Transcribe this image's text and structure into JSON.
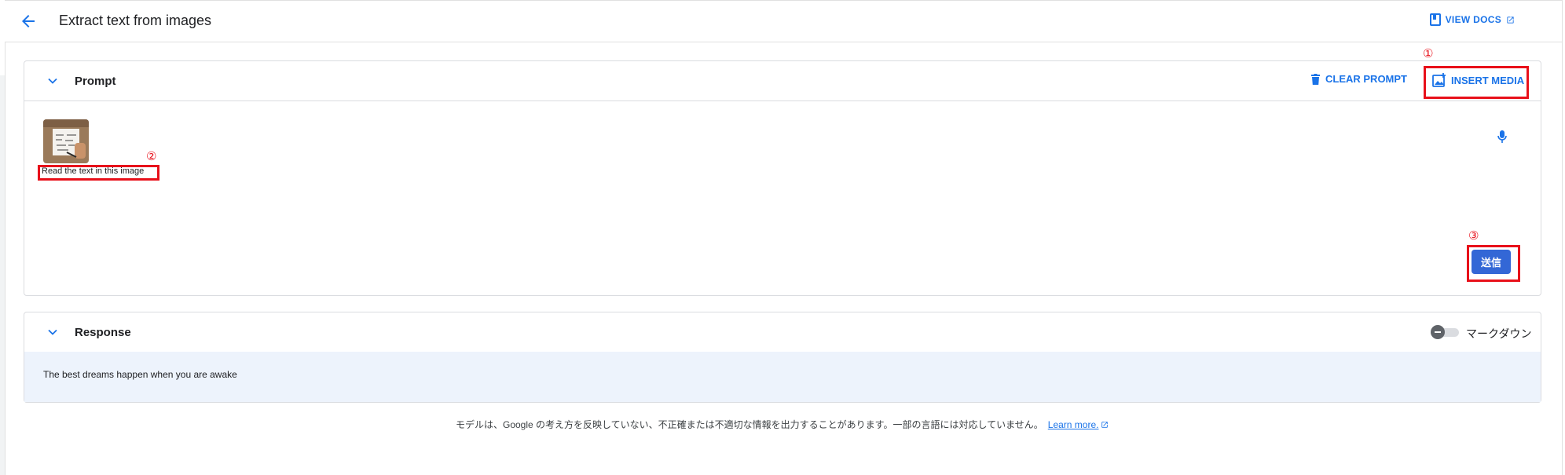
{
  "header": {
    "title": "Extract text from images",
    "view_docs": "VIEW DOCS"
  },
  "prompt_panel": {
    "title": "Prompt",
    "clear_prompt": "CLEAR PROMPT",
    "insert_media": "INSERT MEDIA",
    "prompt_text": "Read the text in this image",
    "send_label": "送信"
  },
  "response_panel": {
    "title": "Response",
    "markdown_label": "マークダウン",
    "response_text": "The best dreams happen when you are awake"
  },
  "footer": {
    "disclaimer": "モデルは、Google の考え方を反映していない、不正確または不適切な情報を出力することがあります。一部の言語には対応していません。",
    "learn_more": "Learn more."
  },
  "annotations": {
    "one": "①",
    "two": "②",
    "three": "③"
  },
  "colors": {
    "accent": "#1a73e8",
    "send_button": "#3367d6",
    "annotation": "#e8101a",
    "response_bg": "#edf3fc"
  },
  "icons": {
    "back": "arrow-back-icon",
    "docs": "book-icon",
    "external": "open-in-new-icon",
    "chevron": "chevron-down-icon",
    "clear": "trash-icon",
    "insert": "add-photo-icon",
    "mic": "mic-icon"
  }
}
